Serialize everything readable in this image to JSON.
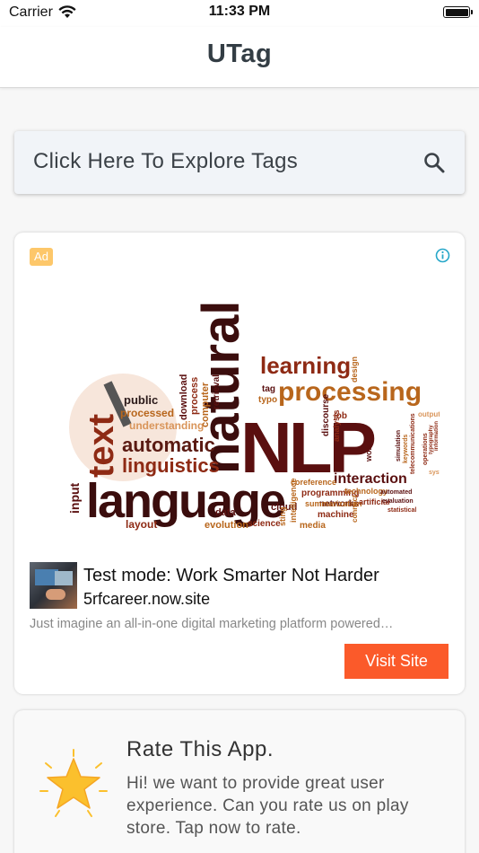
{
  "status_bar": {
    "carrier": "Carrier",
    "time": "11:33 PM"
  },
  "nav": {
    "title": "UTag"
  },
  "search": {
    "label": "Click Here To Explore Tags",
    "icon": "search-icon"
  },
  "ad": {
    "badge": "Ad",
    "info_icon": "info-icon",
    "headline": "Test mode: Work Smarter Not Harder",
    "domain": "5rfcareer.now.site",
    "description": "Just imagine an all-in-one digital marketing platform powered…",
    "cta": "Visit Site",
    "cta_color": "#fb5a2a",
    "badge_color": "#fdc76a"
  },
  "rate": {
    "title": "Rate This App.",
    "body": "Hi! we want to provide great user experience. Can you rate us on play store. Tap now to rate.",
    "icon": "star-icon",
    "star_color": "#fbc02d"
  },
  "wordcloud": {
    "words": [
      "language",
      "NLP",
      "natural",
      "text",
      "automatic",
      "linguistics",
      "processing",
      "learning",
      "interaction",
      "input",
      "layout",
      "evolution",
      "data",
      "science",
      "cloud",
      "networks",
      "machine",
      "media",
      "public",
      "processed",
      "understanding",
      "computer",
      "download",
      "process",
      "retrieval",
      "tag",
      "typo",
      "discourse",
      "analysis",
      "job",
      "design",
      "word",
      "output",
      "coreference",
      "programming",
      "technology",
      "summarization",
      "artificial",
      "automated",
      "evaluation",
      "statistical",
      "intelligence",
      "connect",
      "telecommunications",
      "simulation",
      "keywords",
      "operations",
      "systems",
      "human",
      "information",
      "typography",
      "sting"
    ]
  }
}
